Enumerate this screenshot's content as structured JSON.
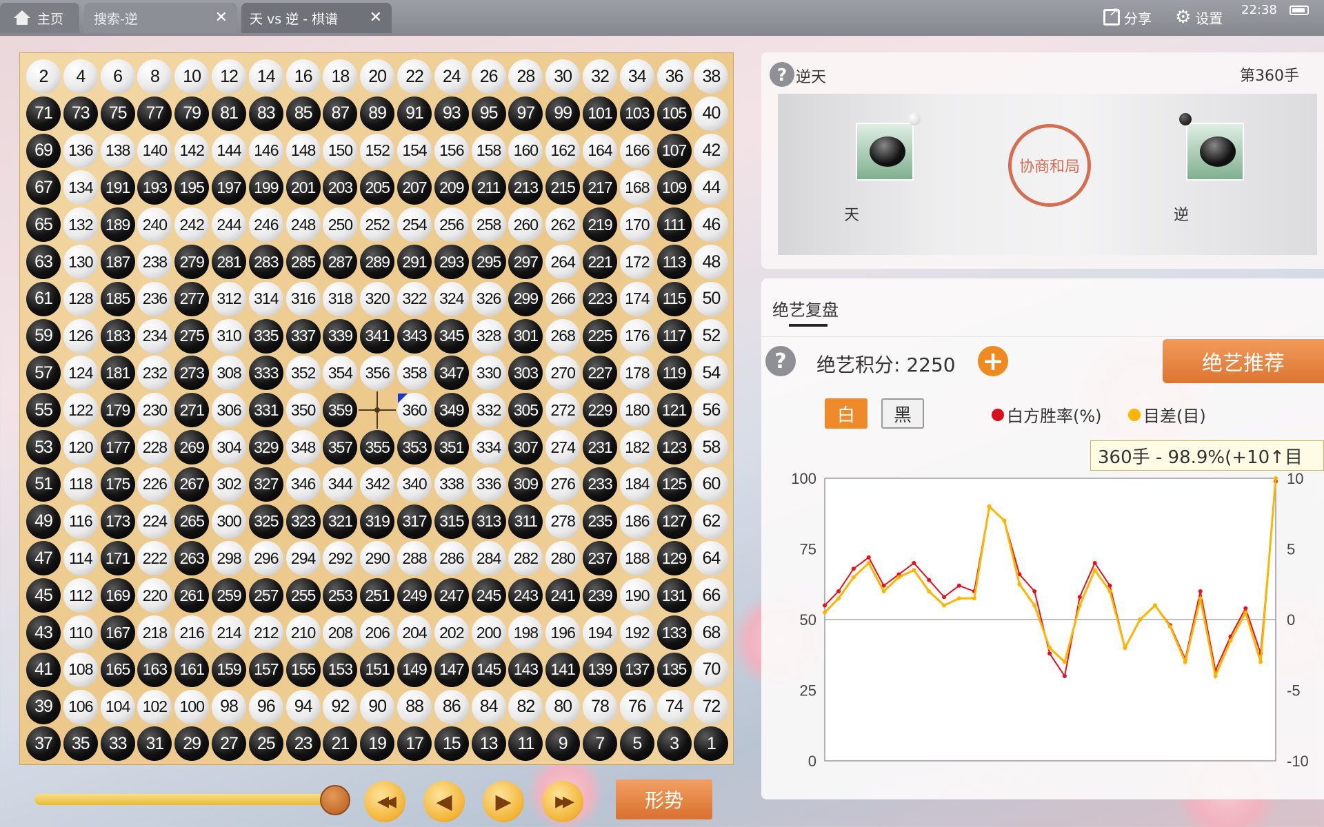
{
  "tabs": {
    "home": "主页",
    "search": "搜索-逆",
    "game": "天 vs 逆 - 棋谱",
    "close_glyph": "✕"
  },
  "toolbar": {
    "share": "分享",
    "settings": "设置",
    "clock": "22:38"
  },
  "board": {
    "size": 19,
    "rows": [
      [
        2,
        4,
        6,
        8,
        10,
        12,
        14,
        16,
        18,
        20,
        22,
        24,
        26,
        28,
        30,
        32,
        34,
        36,
        38
      ],
      [
        71,
        73,
        75,
        77,
        79,
        81,
        83,
        85,
        87,
        89,
        91,
        93,
        95,
        97,
        99,
        101,
        103,
        105,
        40
      ],
      [
        69,
        136,
        138,
        140,
        142,
        144,
        146,
        148,
        150,
        152,
        154,
        156,
        158,
        160,
        162,
        164,
        166,
        107,
        42
      ],
      [
        67,
        134,
        191,
        193,
        195,
        197,
        199,
        201,
        203,
        205,
        207,
        209,
        211,
        213,
        215,
        217,
        168,
        109,
        44
      ],
      [
        65,
        132,
        189,
        240,
        242,
        244,
        246,
        248,
        250,
        252,
        254,
        256,
        258,
        260,
        262,
        219,
        170,
        111,
        46
      ],
      [
        63,
        130,
        187,
        238,
        279,
        281,
        283,
        285,
        287,
        289,
        291,
        293,
        295,
        297,
        264,
        221,
        172,
        113,
        48
      ],
      [
        61,
        128,
        185,
        236,
        277,
        312,
        314,
        316,
        318,
        320,
        322,
        324,
        326,
        299,
        266,
        223,
        174,
        115,
        50
      ],
      [
        59,
        126,
        183,
        234,
        275,
        310,
        335,
        337,
        339,
        341,
        343,
        345,
        328,
        301,
        268,
        225,
        176,
        117,
        52
      ],
      [
        57,
        124,
        181,
        232,
        273,
        308,
        333,
        352,
        354,
        356,
        358,
        347,
        330,
        303,
        270,
        227,
        178,
        119,
        54
      ],
      [
        55,
        122,
        179,
        230,
        271,
        306,
        331,
        350,
        359,
        null,
        360,
        349,
        332,
        305,
        272,
        229,
        180,
        121,
        56
      ],
      [
        53,
        120,
        177,
        228,
        269,
        304,
        329,
        348,
        357,
        355,
        353,
        351,
        334,
        307,
        274,
        231,
        182,
        123,
        58
      ],
      [
        51,
        118,
        175,
        226,
        267,
        302,
        327,
        346,
        344,
        342,
        340,
        338,
        336,
        309,
        276,
        233,
        184,
        125,
        60
      ],
      [
        49,
        116,
        173,
        224,
        265,
        300,
        325,
        323,
        321,
        319,
        317,
        315,
        313,
        311,
        278,
        235,
        186,
        127,
        62
      ],
      [
        47,
        114,
        171,
        222,
        263,
        298,
        296,
        294,
        292,
        290,
        288,
        286,
        284,
        282,
        280,
        237,
        188,
        129,
        64
      ],
      [
        45,
        112,
        169,
        220,
        261,
        259,
        257,
        255,
        253,
        251,
        249,
        247,
        245,
        243,
        241,
        239,
        190,
        131,
        66
      ],
      [
        43,
        110,
        167,
        218,
        216,
        214,
        212,
        210,
        208,
        206,
        204,
        202,
        200,
        198,
        196,
        194,
        192,
        133,
        68
      ],
      [
        41,
        108,
        165,
        163,
        161,
        159,
        157,
        155,
        153,
        151,
        149,
        147,
        145,
        143,
        141,
        139,
        137,
        135,
        70
      ],
      [
        39,
        106,
        104,
        102,
        100,
        98,
        96,
        94,
        92,
        90,
        88,
        86,
        84,
        82,
        80,
        78,
        76,
        74,
        72
      ],
      [
        37,
        35,
        33,
        31,
        29,
        27,
        25,
        23,
        21,
        19,
        17,
        15,
        13,
        11,
        9,
        7,
        5,
        3,
        1
      ]
    ],
    "last_move": 360
  },
  "controls": {
    "trend": "形势",
    "first": "◀◀",
    "prev": "◀",
    "next": "▶",
    "last": "▶▶",
    "progress": 1.0
  },
  "info": {
    "title": "逆天",
    "move_count": "第360手",
    "result": "协商和局",
    "player_white": "天",
    "player_black": "逆"
  },
  "analysis": {
    "tab": "绝艺复盘",
    "score_label": "绝艺积分: 2250",
    "add": "+",
    "recommend": "绝艺推荐",
    "white_btn": "白",
    "black_btn": "黑",
    "legend_winrate": "白方胜率(%)",
    "legend_diff": "目差(目)",
    "tooltip": "360手 - 98.9%(+10↑目",
    "colors": {
      "winrate": "#e8101e",
      "diff": "#ffb400"
    }
  },
  "chart_data": {
    "type": "line",
    "x": [
      1,
      12,
      24,
      36,
      48,
      60,
      72,
      84,
      96,
      108,
      120,
      132,
      144,
      156,
      168,
      180,
      192,
      204,
      216,
      228,
      240,
      252,
      264,
      276,
      288,
      300,
      312,
      324,
      336,
      348,
      360
    ],
    "series": [
      {
        "name": "白方胜率(%)",
        "values": [
          55,
          60,
          68,
          72,
          62,
          66,
          70,
          64,
          58,
          62,
          60,
          90,
          85,
          66,
          60,
          38,
          30,
          58,
          70,
          62,
          40,
          50,
          55,
          48,
          36,
          60,
          32,
          44,
          54,
          38,
          98.9
        ]
      },
      {
        "name": "目差(目)",
        "values": [
          0.5,
          1.5,
          3,
          4,
          2,
          3,
          3.5,
          2,
          1,
          1.5,
          1.5,
          8,
          7,
          2.5,
          1,
          -2,
          -3,
          1,
          3.5,
          2,
          -2,
          0,
          1,
          -0.5,
          -3,
          1.5,
          -4,
          -1.5,
          0.5,
          -3,
          10
        ]
      }
    ],
    "ylim_left": [
      0,
      100
    ],
    "yticks_left": [
      0,
      25,
      50,
      75,
      100
    ],
    "ylim_right": [
      -10,
      10
    ],
    "yticks_right": [
      -10,
      -5,
      0,
      5,
      10
    ]
  }
}
